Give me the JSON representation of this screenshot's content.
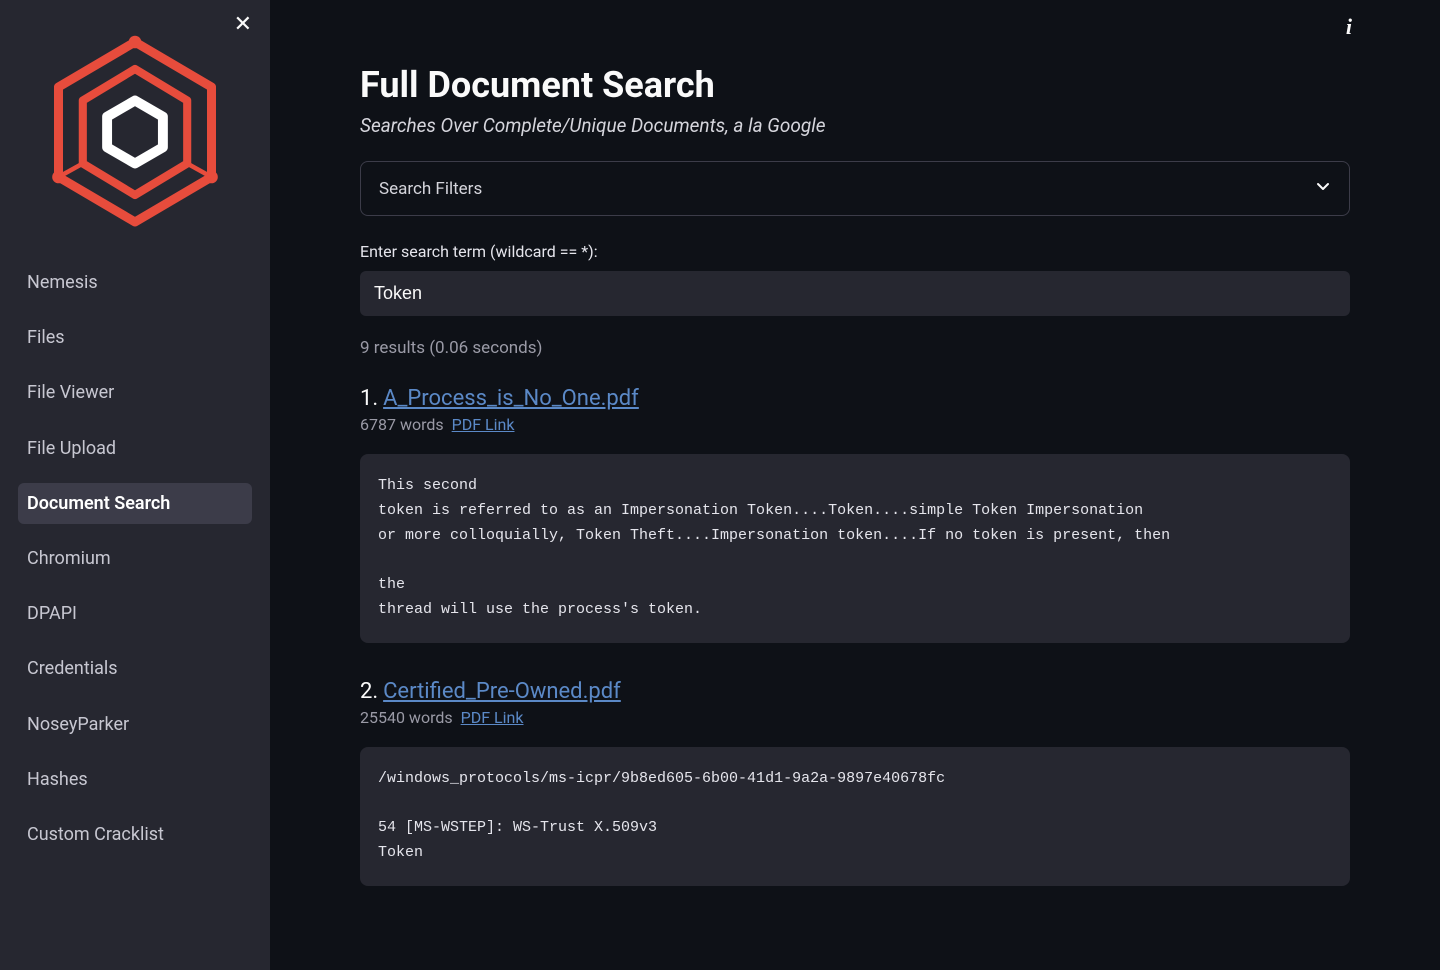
{
  "sidebar": {
    "items": [
      {
        "label": "Nemesis",
        "active": false
      },
      {
        "label": "Files",
        "active": false
      },
      {
        "label": "File Viewer",
        "active": false
      },
      {
        "label": "File Upload",
        "active": false
      },
      {
        "label": "Document Search",
        "active": true
      },
      {
        "label": "Chromium",
        "active": false
      },
      {
        "label": "DPAPI",
        "active": false
      },
      {
        "label": "Credentials",
        "active": false
      },
      {
        "label": "NoseyParker",
        "active": false
      },
      {
        "label": "Hashes",
        "active": false
      },
      {
        "label": "Custom Cracklist",
        "active": false
      }
    ]
  },
  "header": {
    "title": "Full Document Search",
    "subtitle": "Searches Over Complete/Unique Documents, a la Google"
  },
  "filters": {
    "label": "Search Filters"
  },
  "search": {
    "label": "Enter search term (wildcard == *):",
    "value": "Token"
  },
  "results_summary": "9 results (0.06 seconds)",
  "pdf_link_label": "PDF Link",
  "results": [
    {
      "index": "1. ",
      "title": "A_Process_is_No_One.pdf",
      "words": "6787 words",
      "snippet": "This second\ntoken is referred to as an Impersonation Token....Token....simple Token Impersonation\nor more colloquially, Token Theft....Impersonation token....If no token is present, then\n\nthe\nthread will use the process's token."
    },
    {
      "index": "2. ",
      "title": "Certified_Pre-Owned.pdf",
      "words": "25540 words",
      "snippet": "/windows_protocols/ms-icpr/9b8ed605-6b00-41d1-9a2a-9897e40678fc\n\n54 [MS-WSTEP]: WS-Trust X.509v3\nToken"
    }
  ]
}
